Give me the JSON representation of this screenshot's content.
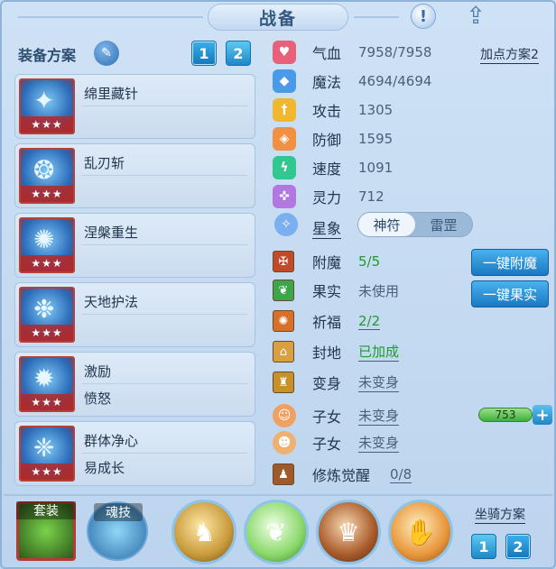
{
  "title": "战备",
  "header": {
    "info_icon": "info-icon",
    "share_icon": "share-icon"
  },
  "scheme": {
    "label": "装备方案",
    "edit_icon": "edit-icon",
    "options": [
      "1",
      "2"
    ],
    "selected": "1"
  },
  "skills": [
    {
      "name": "绵里藏针",
      "sub": "",
      "stars": "★★★",
      "icon": "needle-icon"
    },
    {
      "name": "乱刃斩",
      "sub": "",
      "stars": "★★★",
      "icon": "blade-icon"
    },
    {
      "name": "涅槃重生",
      "sub": "",
      "stars": "★★★",
      "icon": "phoenix-icon"
    },
    {
      "name": "天地护法",
      "sub": "",
      "stars": "★★★",
      "icon": "guardian-icon"
    },
    {
      "name": "激励",
      "sub": "愤怒",
      "stars": "★★★",
      "icon": "inspire-icon"
    },
    {
      "name": "群体净心",
      "sub": "易成长",
      "stars": "★★★",
      "icon": "purify-icon"
    }
  ],
  "stats": [
    {
      "label": "气血",
      "value": "7958/7958",
      "icon": "heart-icon",
      "color": "#e8607a"
    },
    {
      "label": "魔法",
      "value": "4694/4694",
      "icon": "mana-icon",
      "color": "#4a9ae8"
    },
    {
      "label": "攻击",
      "value": "1305",
      "icon": "attack-icon",
      "color": "#f0b830"
    },
    {
      "label": "防御",
      "value": "1595",
      "icon": "defense-icon",
      "color": "#f09040"
    },
    {
      "label": "速度",
      "value": "1091",
      "icon": "speed-icon",
      "color": "#30c890"
    },
    {
      "label": "灵力",
      "value": "712",
      "icon": "spirit-icon",
      "color": "#b078e0"
    }
  ],
  "add_point": "加点方案2",
  "star_sign": {
    "label": "星象",
    "options": [
      "神符",
      "雷罡"
    ],
    "selected": "神符",
    "icon": "star-sign-icon"
  },
  "features": [
    {
      "label": "附魔",
      "value": "5/5",
      "style": "green",
      "icon": "enchant-icon",
      "color": "#c04a2a"
    },
    {
      "label": "果实",
      "value": "未使用",
      "style": "plain",
      "icon": "fruit-icon",
      "color": "#3aa84a"
    },
    {
      "label": "祈福",
      "value": "2/2",
      "style": "green-ul",
      "icon": "bless-icon",
      "color": "#d8702a"
    },
    {
      "label": "封地",
      "value": "已加成",
      "style": "green-ul",
      "icon": "fief-icon",
      "color": "#d8a040"
    },
    {
      "label": "变身",
      "value": "未变身",
      "style": "ul",
      "icon": "transform-icon",
      "color": "#c8902a"
    },
    {
      "label": "子女",
      "value": "未变身",
      "style": "ul",
      "icon": "child-icon",
      "color": "#f0a060"
    },
    {
      "label": "子女",
      "value": "未变身",
      "style": "ul",
      "icon": "child2-icon",
      "color": "#f0b070"
    },
    {
      "label": "修炼觉醒",
      "value": "0/8",
      "style": "ul",
      "icon": "cultivate-icon",
      "color": "#a05a2a"
    }
  ],
  "actions": {
    "enchant": "一键附魔",
    "fruit": "一键果实"
  },
  "child_exp": {
    "value": "753",
    "plus": "+"
  },
  "bottom": {
    "suit_label": "套装",
    "soul_label": "魂技",
    "orbs": [
      "warrior-orb-icon",
      "leaf-orb-icon",
      "beast-orb-icon",
      "monk-orb-icon"
    ],
    "mount_label": "坐骑方案",
    "mount_options": [
      "1",
      "2"
    ],
    "mount_selected": "2"
  }
}
